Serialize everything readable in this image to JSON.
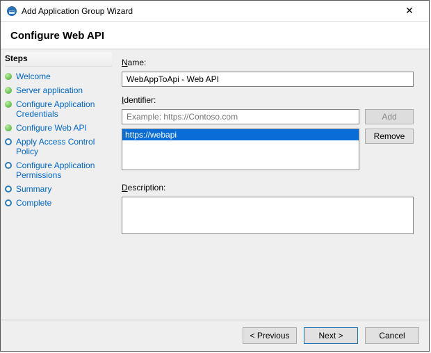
{
  "window": {
    "title": "Add Application Group Wizard"
  },
  "page": {
    "heading": "Configure Web API"
  },
  "sidebar": {
    "heading": "Steps",
    "items": [
      {
        "label": "Welcome",
        "state": "done"
      },
      {
        "label": "Server application",
        "state": "done"
      },
      {
        "label": "Configure Application Credentials",
        "state": "done"
      },
      {
        "label": "Configure Web API",
        "state": "done"
      },
      {
        "label": "Apply Access Control Policy",
        "state": "pending"
      },
      {
        "label": "Configure Application Permissions",
        "state": "pending"
      },
      {
        "label": "Summary",
        "state": "pending"
      },
      {
        "label": "Complete",
        "state": "pending"
      }
    ]
  },
  "form": {
    "name_label": "Name:",
    "name_value": "WebAppToApi - Web API",
    "identifier_label": "Identifier:",
    "identifier_placeholder": "Example: https://Contoso.com",
    "identifier_value": "",
    "identifier_items": [
      {
        "text": "https://webapi",
        "selected": true
      }
    ],
    "add_button": "Add",
    "remove_button": "Remove",
    "description_label": "Description:",
    "description_value": ""
  },
  "footer": {
    "previous": "< Previous",
    "next": "Next >",
    "cancel": "Cancel"
  }
}
